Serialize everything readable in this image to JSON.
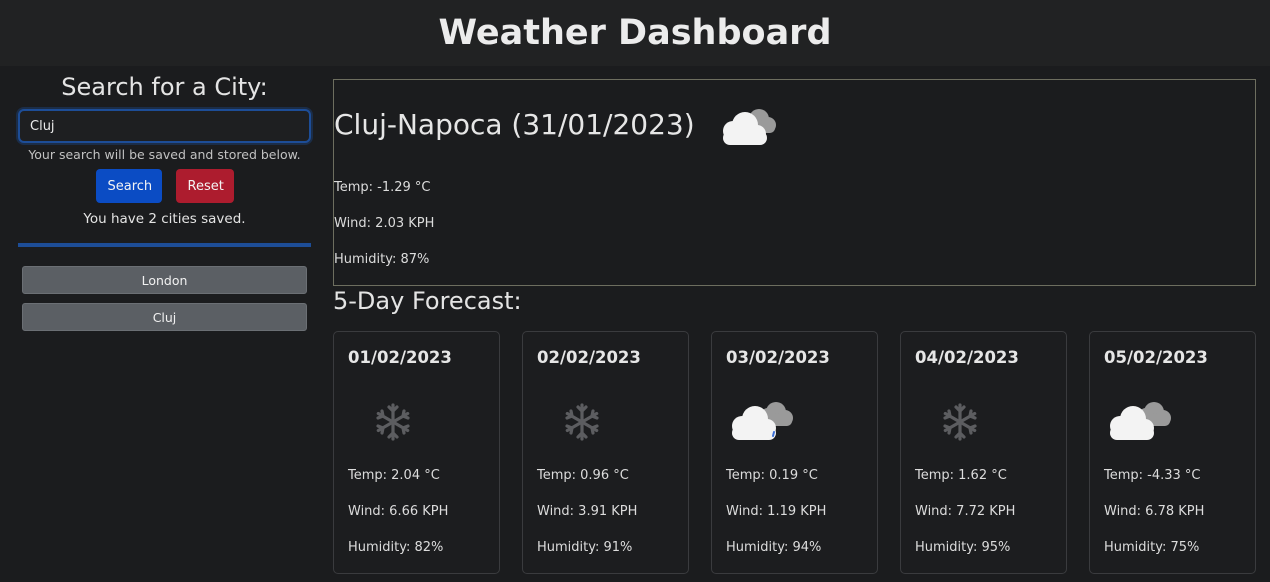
{
  "header": {
    "title": "Weather Dashboard"
  },
  "sidebar": {
    "search_title": "Search for a City:",
    "search_value": "Cluj",
    "helper_text": "Your search will be saved and stored below.",
    "search_label": "Search",
    "reset_label": "Reset",
    "saved_text": "You have 2 cities saved.",
    "cities": [
      "London",
      "Cluj"
    ]
  },
  "current": {
    "title": "Cluj-Napoca (31/01/2023)",
    "icon": "cloudy-icon",
    "temp": "Temp: -1.29 °C",
    "wind": "Wind: 2.03 KPH",
    "humidity": "Humidity: 87%"
  },
  "forecast": {
    "title": "5-Day Forecast:",
    "days": [
      {
        "date": "01/02/2023",
        "icon": "snowflake-icon",
        "temp": "Temp: 2.04 °C",
        "wind": "Wind: 6.66 KPH",
        "humidity": "Humidity: 82%"
      },
      {
        "date": "02/02/2023",
        "icon": "snowflake-icon",
        "temp": "Temp: 0.96 °C",
        "wind": "Wind: 3.91 KPH",
        "humidity": "Humidity: 91%"
      },
      {
        "date": "03/02/2023",
        "icon": "rain-cloud-icon",
        "temp": "Temp: 0.19 °C",
        "wind": "Wind: 1.19 KPH",
        "humidity": "Humidity: 94%"
      },
      {
        "date": "04/02/2023",
        "icon": "snowflake-icon",
        "temp": "Temp: 1.62 °C",
        "wind": "Wind: 7.72 KPH",
        "humidity": "Humidity: 95%"
      },
      {
        "date": "05/02/2023",
        "icon": "cloudy-icon",
        "temp": "Temp: -4.33 °C",
        "wind": "Wind: 6.78 KPH",
        "humidity": "Humidity: 75%"
      }
    ]
  }
}
